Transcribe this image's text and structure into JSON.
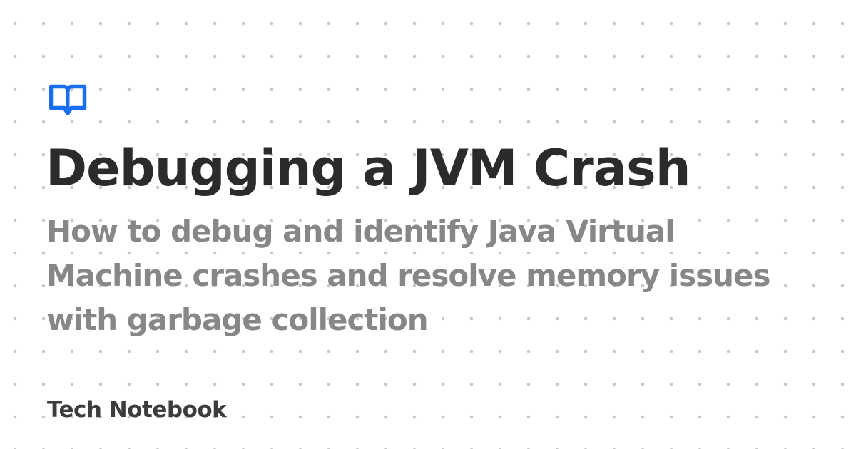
{
  "card": {
    "logo_icon": "open-book-icon",
    "title": "Debugging a JVM Crash",
    "subtitle": "How to debug and identify Java Virtual Machine crashes and resolve memory issues with garbage collection",
    "site_name": "Tech Notebook"
  },
  "colors": {
    "background": "#ffffff",
    "accent": "#1a6ff0",
    "title": "#2b2b2b",
    "subtitle": "#878787",
    "brand": "#3c3c3c",
    "pattern": "#c8c8c8"
  }
}
